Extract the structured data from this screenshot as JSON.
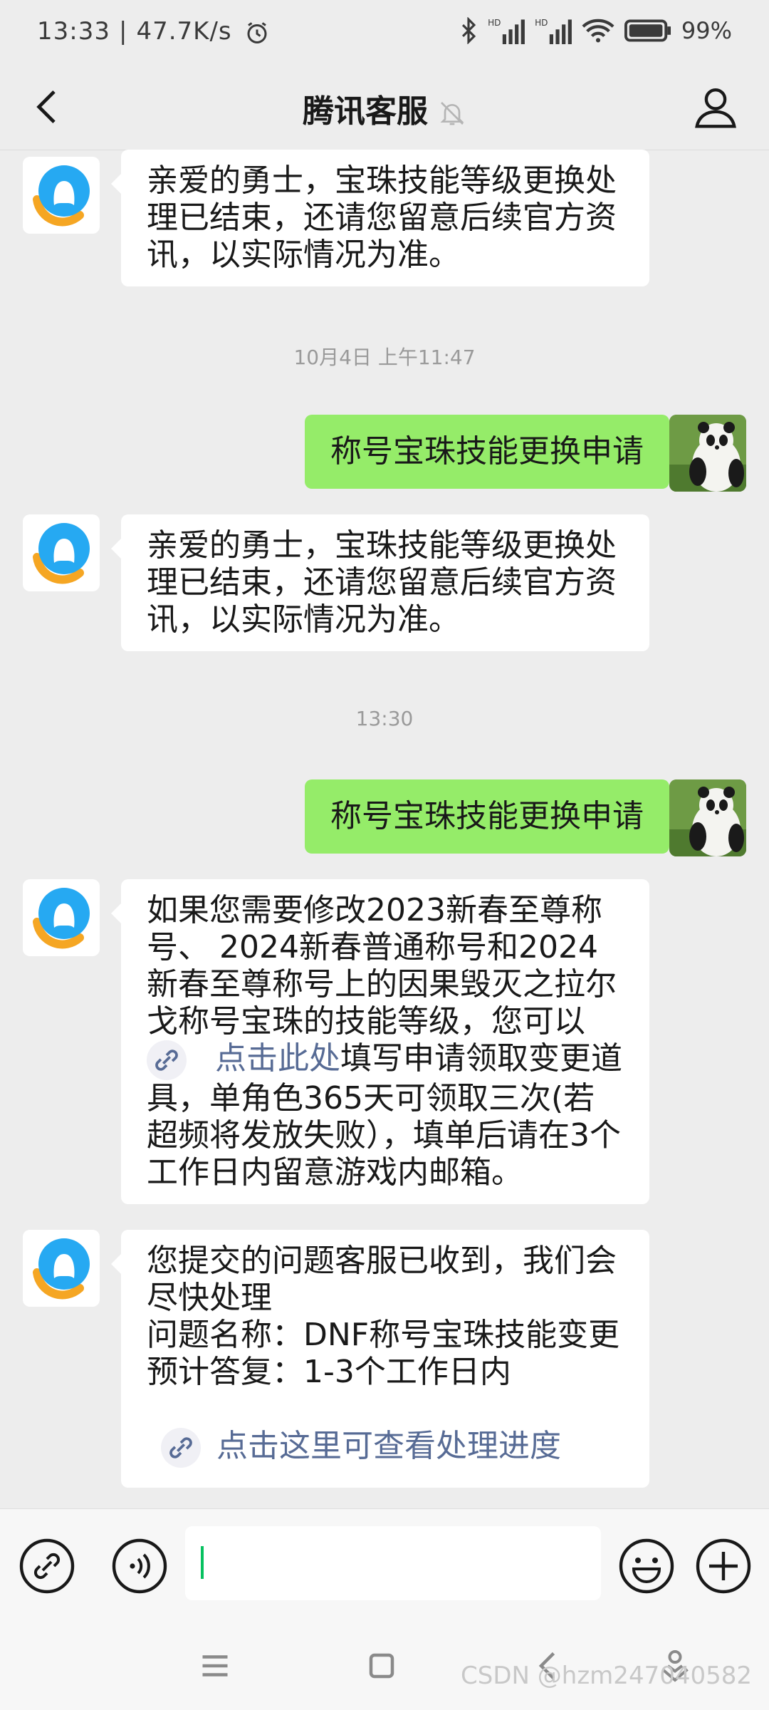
{
  "status_bar": {
    "time": "13:33",
    "speed": "47.7K/s",
    "battery": "99%",
    "icons": [
      "alarm-icon",
      "bluetooth-icon",
      "signal-hd-icon",
      "signal-hd-icon",
      "wifi-icon",
      "battery-icon"
    ]
  },
  "header": {
    "title": "腾讯客服",
    "icons": {
      "back": "chevron-left-icon",
      "mute": "bell-off-icon",
      "profile": "person-icon"
    }
  },
  "messages": [
    {
      "from": "service",
      "text": "亲爱的勇士，宝珠技能等级更换处理已结束，还请您留意后续官方资讯，以实际情况为准。"
    },
    {
      "timestamp": "10月4日 上午11:47"
    },
    {
      "from": "me",
      "text": "称号宝珠技能更换申请"
    },
    {
      "from": "service",
      "text": "亲爱的勇士，宝珠技能等级更换处理已结束，还请您留意后续官方资讯，以实际情况为准。"
    },
    {
      "timestamp": "13:30"
    },
    {
      "from": "me",
      "text": "称号宝珠技能更换申请"
    },
    {
      "from": "service",
      "text_before": "如果您需要修改2023新春至尊称号、 2024新春普通称号和2024新春至尊称号上的因果毁灭之拉尔戈称号宝珠的技能等级，您可以",
      "link": "点击此处",
      "text_after": "填写申请领取变更道具，单角色365天可领取三次(若超频将发放失败），填单后请在3个工作日内留意游戏内邮箱。"
    },
    {
      "from": "service",
      "line1": "您提交的问题客服已收到，我们会尽快处理",
      "line2": "问题名称：DNF称号宝珠技能变更",
      "line3": "预计答复：1-3个工作日内",
      "link": "点击这里可查看处理进度"
    }
  ],
  "input_bar": {
    "icons": [
      "link-icon",
      "voice-icon",
      "emoji-icon",
      "plus-icon"
    ],
    "value": ""
  },
  "system_nav": {
    "icons": [
      "menu-icon",
      "home-square-icon",
      "back-icon",
      "assistant-icon"
    ]
  },
  "watermark": "CSDN @hzm247040582",
  "colors": {
    "background": "#ededed",
    "my_bubble": "#95ec69",
    "link": "#576b95",
    "caret": "#07c160"
  }
}
